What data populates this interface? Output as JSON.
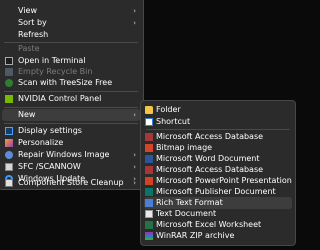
{
  "context_menu": {
    "items": [
      {
        "label": "View",
        "submenu": true
      },
      {
        "label": "Sort by",
        "submenu": true
      },
      {
        "label": "Refresh"
      },
      {
        "label": "Paste",
        "disabled": true
      },
      {
        "label": "Open in Terminal",
        "icon": "terminal-icon"
      },
      {
        "label": "Empty Recycle Bin",
        "icon": "recycle-bin-icon",
        "disabled": true
      },
      {
        "label": "Scan with TreeSize Free",
        "icon": "treesize-icon"
      },
      {
        "label": "NVIDIA Control Panel",
        "icon": "nvidia-icon"
      },
      {
        "label": "New",
        "submenu": true,
        "selected": true
      },
      {
        "label": "Display settings",
        "icon": "display-icon"
      },
      {
        "label": "Personalize",
        "icon": "personalize-icon"
      },
      {
        "label": "Repair Windows Image",
        "icon": "repair-icon",
        "submenu": true
      },
      {
        "label": "SFC /SCANNOW",
        "icon": "sfc-icon",
        "submenu": true
      },
      {
        "label": "Windows Update",
        "icon": "windows-update-icon",
        "submenu": true
      },
      {
        "label": "Component Store Cleanup",
        "icon": "component-store-icon",
        "submenu": true
      }
    ]
  },
  "new_submenu": {
    "items": [
      {
        "label": "Folder",
        "icon": "folder-icon"
      },
      {
        "label": "Shortcut",
        "icon": "shortcut-icon"
      },
      {
        "label": "Microsoft Access Database",
        "icon": "access-icon"
      },
      {
        "label": "Bitmap image",
        "icon": "bitmap-icon"
      },
      {
        "label": "Microsoft Word Document",
        "icon": "word-icon"
      },
      {
        "label": "Microsoft Access Database",
        "icon": "access-icon"
      },
      {
        "label": "Microsoft PowerPoint Presentation",
        "icon": "powerpoint-icon"
      },
      {
        "label": "Microsoft Publisher Document",
        "icon": "publisher-icon"
      },
      {
        "label": "Rich Text Format",
        "icon": "rtf-icon",
        "selected": true
      },
      {
        "label": "Text Document",
        "icon": "text-document-icon"
      },
      {
        "label": "Microsoft Excel Worksheet",
        "icon": "excel-icon"
      },
      {
        "label": "WinRAR ZIP archive",
        "icon": "winrar-icon"
      }
    ]
  },
  "symbols": {
    "submenu_arrow": "›"
  },
  "colors": {
    "menu_background": "#2b2b2b",
    "menu_border": "#474747",
    "selected_background": "#3d3d3d",
    "disabled_text": "#7b7b7b"
  }
}
